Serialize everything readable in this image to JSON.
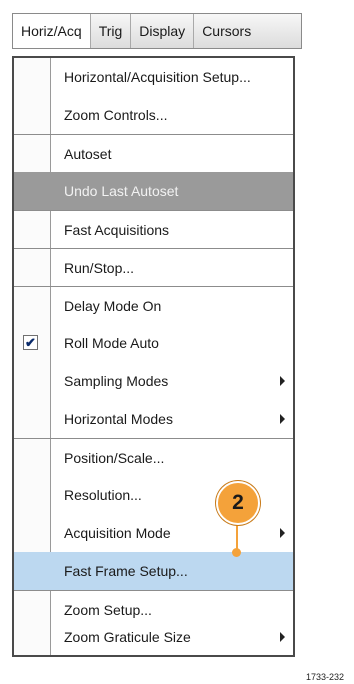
{
  "menubar": {
    "items": [
      {
        "label": "Horiz/Acq",
        "active": true
      },
      {
        "label": "Trig"
      },
      {
        "label": "Display"
      },
      {
        "label": "Cursors"
      }
    ]
  },
  "menu": {
    "items": [
      {
        "label": "Horizontal/Acquisition Setup...",
        "sep": false
      },
      {
        "label": "Zoom Controls...",
        "sep": false
      },
      {
        "label": "Autoset",
        "sep": true
      },
      {
        "label": "Undo Last Autoset",
        "sep": false,
        "disabled": true
      },
      {
        "label": "Fast Acquisitions",
        "sep": true
      },
      {
        "label": "Run/Stop...",
        "sep": true
      },
      {
        "label": "Delay Mode On",
        "sep": true
      },
      {
        "label": "Roll Mode Auto",
        "sep": false,
        "checked": true
      },
      {
        "label": "Sampling Modes",
        "sep": false,
        "submenu": true
      },
      {
        "label": "Horizontal Modes",
        "sep": false,
        "submenu": true
      },
      {
        "label": "Position/Scale...",
        "sep": true
      },
      {
        "label": "Resolution...",
        "sep": false
      },
      {
        "label": "Acquisition Mode",
        "sep": false,
        "submenu": true
      },
      {
        "label": "Fast Frame Setup...",
        "sep": false,
        "highlighted": true
      },
      {
        "label": "Zoom Setup...",
        "sep": true
      },
      {
        "label": "Zoom Graticule Size",
        "sep": false,
        "submenu": true
      }
    ]
  },
  "callout": {
    "number": "2",
    "color": "#f4a23a"
  },
  "figure_code": "1733-232",
  "colors": {
    "highlight": "#bcd8f0",
    "disabled": "#9a9a9a"
  }
}
